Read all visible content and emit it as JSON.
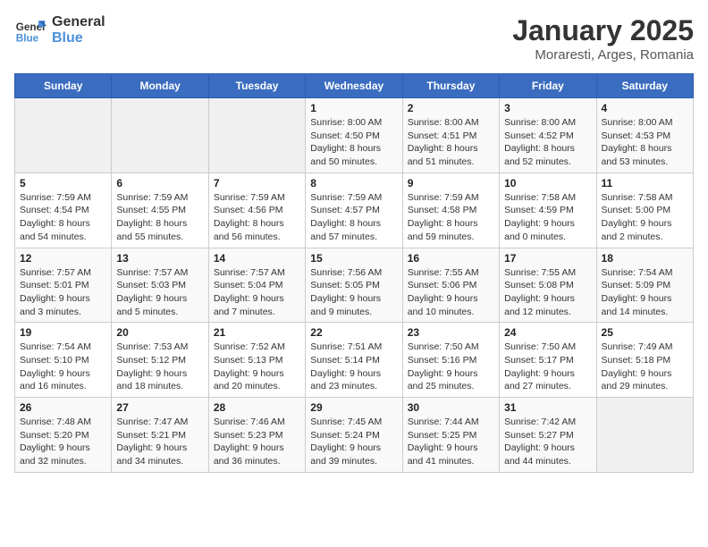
{
  "logo": {
    "line1": "General",
    "line2": "Blue"
  },
  "title": "January 2025",
  "subtitle": "Moraresti, Arges, Romania",
  "days_of_week": [
    "Sunday",
    "Monday",
    "Tuesday",
    "Wednesday",
    "Thursday",
    "Friday",
    "Saturday"
  ],
  "weeks": [
    [
      {
        "day": "",
        "info": ""
      },
      {
        "day": "",
        "info": ""
      },
      {
        "day": "",
        "info": ""
      },
      {
        "day": "1",
        "info": "Sunrise: 8:00 AM\nSunset: 4:50 PM\nDaylight: 8 hours\nand 50 minutes."
      },
      {
        "day": "2",
        "info": "Sunrise: 8:00 AM\nSunset: 4:51 PM\nDaylight: 8 hours\nand 51 minutes."
      },
      {
        "day": "3",
        "info": "Sunrise: 8:00 AM\nSunset: 4:52 PM\nDaylight: 8 hours\nand 52 minutes."
      },
      {
        "day": "4",
        "info": "Sunrise: 8:00 AM\nSunset: 4:53 PM\nDaylight: 8 hours\nand 53 minutes."
      }
    ],
    [
      {
        "day": "5",
        "info": "Sunrise: 7:59 AM\nSunset: 4:54 PM\nDaylight: 8 hours\nand 54 minutes."
      },
      {
        "day": "6",
        "info": "Sunrise: 7:59 AM\nSunset: 4:55 PM\nDaylight: 8 hours\nand 55 minutes."
      },
      {
        "day": "7",
        "info": "Sunrise: 7:59 AM\nSunset: 4:56 PM\nDaylight: 8 hours\nand 56 minutes."
      },
      {
        "day": "8",
        "info": "Sunrise: 7:59 AM\nSunset: 4:57 PM\nDaylight: 8 hours\nand 57 minutes."
      },
      {
        "day": "9",
        "info": "Sunrise: 7:59 AM\nSunset: 4:58 PM\nDaylight: 8 hours\nand 59 minutes."
      },
      {
        "day": "10",
        "info": "Sunrise: 7:58 AM\nSunset: 4:59 PM\nDaylight: 9 hours\nand 0 minutes."
      },
      {
        "day": "11",
        "info": "Sunrise: 7:58 AM\nSunset: 5:00 PM\nDaylight: 9 hours\nand 2 minutes."
      }
    ],
    [
      {
        "day": "12",
        "info": "Sunrise: 7:57 AM\nSunset: 5:01 PM\nDaylight: 9 hours\nand 3 minutes."
      },
      {
        "day": "13",
        "info": "Sunrise: 7:57 AM\nSunset: 5:03 PM\nDaylight: 9 hours\nand 5 minutes."
      },
      {
        "day": "14",
        "info": "Sunrise: 7:57 AM\nSunset: 5:04 PM\nDaylight: 9 hours\nand 7 minutes."
      },
      {
        "day": "15",
        "info": "Sunrise: 7:56 AM\nSunset: 5:05 PM\nDaylight: 9 hours\nand 9 minutes."
      },
      {
        "day": "16",
        "info": "Sunrise: 7:55 AM\nSunset: 5:06 PM\nDaylight: 9 hours\nand 10 minutes."
      },
      {
        "day": "17",
        "info": "Sunrise: 7:55 AM\nSunset: 5:08 PM\nDaylight: 9 hours\nand 12 minutes."
      },
      {
        "day": "18",
        "info": "Sunrise: 7:54 AM\nSunset: 5:09 PM\nDaylight: 9 hours\nand 14 minutes."
      }
    ],
    [
      {
        "day": "19",
        "info": "Sunrise: 7:54 AM\nSunset: 5:10 PM\nDaylight: 9 hours\nand 16 minutes."
      },
      {
        "day": "20",
        "info": "Sunrise: 7:53 AM\nSunset: 5:12 PM\nDaylight: 9 hours\nand 18 minutes."
      },
      {
        "day": "21",
        "info": "Sunrise: 7:52 AM\nSunset: 5:13 PM\nDaylight: 9 hours\nand 20 minutes."
      },
      {
        "day": "22",
        "info": "Sunrise: 7:51 AM\nSunset: 5:14 PM\nDaylight: 9 hours\nand 23 minutes."
      },
      {
        "day": "23",
        "info": "Sunrise: 7:50 AM\nSunset: 5:16 PM\nDaylight: 9 hours\nand 25 minutes."
      },
      {
        "day": "24",
        "info": "Sunrise: 7:50 AM\nSunset: 5:17 PM\nDaylight: 9 hours\nand 27 minutes."
      },
      {
        "day": "25",
        "info": "Sunrise: 7:49 AM\nSunset: 5:18 PM\nDaylight: 9 hours\nand 29 minutes."
      }
    ],
    [
      {
        "day": "26",
        "info": "Sunrise: 7:48 AM\nSunset: 5:20 PM\nDaylight: 9 hours\nand 32 minutes."
      },
      {
        "day": "27",
        "info": "Sunrise: 7:47 AM\nSunset: 5:21 PM\nDaylight: 9 hours\nand 34 minutes."
      },
      {
        "day": "28",
        "info": "Sunrise: 7:46 AM\nSunset: 5:23 PM\nDaylight: 9 hours\nand 36 minutes."
      },
      {
        "day": "29",
        "info": "Sunrise: 7:45 AM\nSunset: 5:24 PM\nDaylight: 9 hours\nand 39 minutes."
      },
      {
        "day": "30",
        "info": "Sunrise: 7:44 AM\nSunset: 5:25 PM\nDaylight: 9 hours\nand 41 minutes."
      },
      {
        "day": "31",
        "info": "Sunrise: 7:42 AM\nSunset: 5:27 PM\nDaylight: 9 hours\nand 44 minutes."
      },
      {
        "day": "",
        "info": ""
      }
    ]
  ]
}
